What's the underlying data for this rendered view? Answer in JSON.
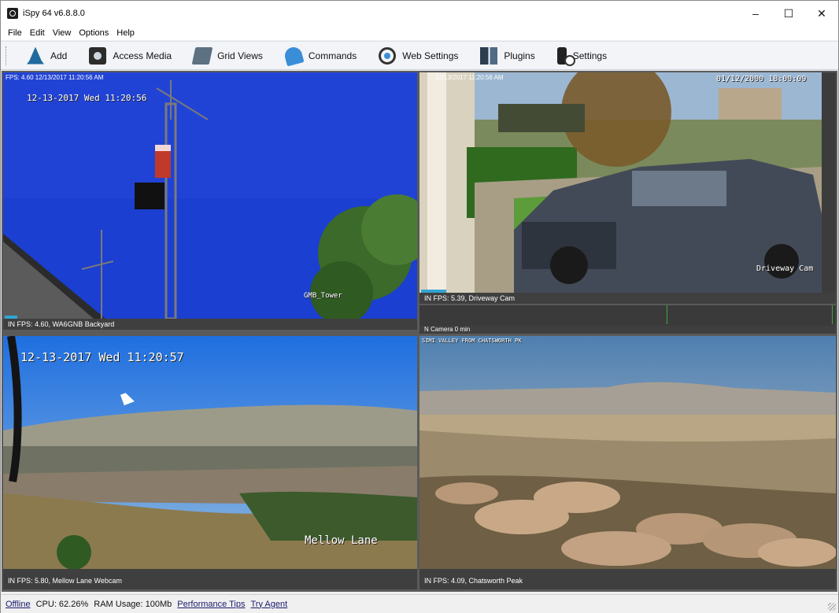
{
  "window": {
    "title": "iSpy 64 v6.8.8.0",
    "minimize": "–",
    "maximize": "☐",
    "close": "✕"
  },
  "menu": [
    "File",
    "Edit",
    "View",
    "Options",
    "Help"
  ],
  "toolbar": [
    {
      "label": "Add",
      "icon": "add-camera-icon"
    },
    {
      "label": "Access Media",
      "icon": "access-media-icon"
    },
    {
      "label": "Grid Views",
      "icon": "grid-views-icon"
    },
    {
      "label": "Commands",
      "icon": "commands-icon"
    },
    {
      "label": "Web Settings",
      "icon": "web-settings-icon"
    },
    {
      "label": "Plugins",
      "icon": "plugins-icon"
    },
    {
      "label": "Settings",
      "icon": "settings-icon"
    }
  ],
  "cameras": {
    "backyard": {
      "overlay": "FPS: 4.60 12/13/2017 11:20:56 AM",
      "osd_time": "12-13-2017 Wed 11:20:56",
      "osd_label": "GMB_Tower",
      "status": "IN  FPS: 4.60, WA6GNB Backyard",
      "level": 0.03
    },
    "driveway": {
      "overlay": "12/13/2017 11:20:56 AM",
      "osd_time": "01/12/2000 18:00:09",
      "osd_label": "Driveway Cam",
      "status": "IN  FPS: 5.39, Driveway Cam",
      "level": 0.06
    },
    "camera0": {
      "status": "N  Camera 0 min"
    },
    "mellow": {
      "osd_time": "12-13-2017 Wed 11:20:57",
      "osd_label": "Mellow Lane",
      "status": "IN  FPS: 5.80, Mellow Lane Webcam"
    },
    "chatsworth": {
      "osd_time": "SIMI VALLEY FROM CHATSWORTH PK",
      "status": "IN  FPS: 4.09, Chatsworth Peak"
    }
  },
  "statusbar": {
    "offline": "Offline",
    "cpu": "CPU: 62.26%",
    "ram": "RAM Usage: 100Mb",
    "perf_tips": "Performance Tips",
    "try_agent": "Try Agent"
  }
}
